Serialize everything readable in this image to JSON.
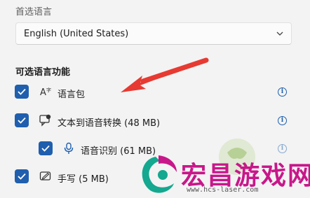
{
  "preferred_language": {
    "label": "首选语言",
    "dropdown_value": "English (United States)"
  },
  "optional_features": {
    "heading": "可选语言功能",
    "items": [
      {
        "label": "语言包",
        "icon": "language-pack-icon",
        "checked": true
      },
      {
        "label": "文本到语音转换 (48 MB)",
        "icon": "text-to-speech-icon",
        "checked": true
      },
      {
        "label": "语音识别 (61 MB)",
        "icon": "microphone-icon",
        "checked": true
      },
      {
        "label": "手写 (5 MB)",
        "icon": "handwriting-icon",
        "checked": true
      }
    ]
  },
  "info_glyph": "i",
  "watermark": {
    "title": "宏昌游戏网",
    "url": "www.hcs-laser.com"
  },
  "colors": {
    "accent": "#1f5fae",
    "arrow": "#e63a32",
    "watermark": "#c8178a"
  }
}
